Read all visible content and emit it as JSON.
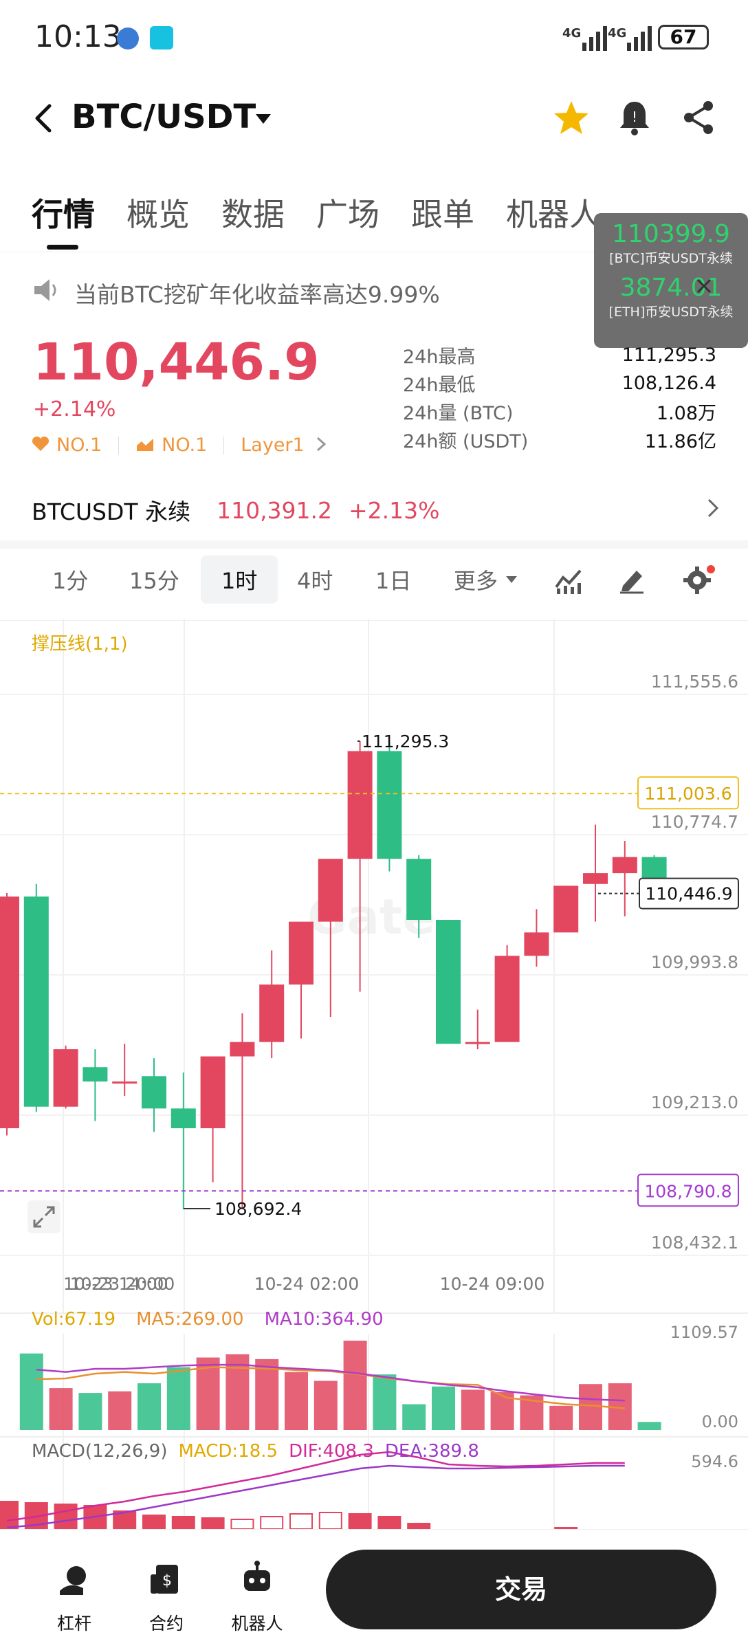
{
  "status_bar": {
    "time": "10:13",
    "battery": "67",
    "net1": "4G",
    "net2": "4G"
  },
  "header": {
    "pair": "BTC/USDT"
  },
  "tabs": [
    {
      "label": "行情",
      "active": true
    },
    {
      "label": "概览"
    },
    {
      "label": "数据"
    },
    {
      "label": "广场"
    },
    {
      "label": "跟单"
    },
    {
      "label": "机器人"
    }
  ],
  "float_widget": {
    "btc_price": "110399.9",
    "btc_label": "[BTC]币安USDT永续",
    "eth_price": "3874.01",
    "eth_label": "[ETH]币安USDT永续"
  },
  "announcement": "当前BTC挖矿年化收益率高达9.99%",
  "price": {
    "last": "110,446.9",
    "change": "+2.14%",
    "tags": [
      "NO.1",
      "NO.1",
      "Layer1"
    ]
  },
  "stats": [
    {
      "label": "24h最高",
      "value": "111,295.3"
    },
    {
      "label": "24h最低",
      "value": "108,126.4"
    },
    {
      "label": "24h量 (BTC)",
      "value": "1.08万"
    },
    {
      "label": "24h额 (USDT)",
      "value": "11.86亿"
    }
  ],
  "perp": {
    "name": "BTCUSDT 永续",
    "price": "110,391.2",
    "change": "+2.13%"
  },
  "timeframes": [
    "1分",
    "15分",
    "1时",
    "4时",
    "1日",
    "更多"
  ],
  "chart": {
    "indicator": "撑压线(1,1)",
    "watermark": "Gate",
    "price_ticks": [
      "111,555.6",
      "110,774.7",
      "109,993.8",
      "109,213.0",
      "108,432.1"
    ],
    "resistance": "111,003.6",
    "support": "108,790.8",
    "current": "110,446.9",
    "high_label": "111,295.3",
    "low_label": "108,692.4",
    "time_ticks": [
      "10-23 14:00",
      "10-23 20:00",
      "10-24 02:00",
      "10-24 09:00"
    ],
    "vol_label": "Vol:67.19",
    "ma5_label": "MA5:269.00",
    "ma10_label": "MA10:364.90",
    "vol_ticks": [
      "1109.57",
      "0.00"
    ],
    "macd_title": "MACD(12,26,9)",
    "macd_label": "MACD:18.5",
    "dif_label": "DIF:408.3",
    "dea_label": "DEA:389.8",
    "macd_tick": "594.6",
    "colors": {
      "up": "#e2475f",
      "down": "#2dbd85",
      "support": "#a33bd0",
      "resistance": "#f0c020"
    }
  },
  "chart_data": {
    "type": "candlestick",
    "interval": "1时",
    "candles": [
      {
        "o": 109140,
        "h": 110450,
        "l": 109100,
        "c": 110430
      },
      {
        "o": 110430,
        "h": 110500,
        "l": 109230,
        "c": 109260
      },
      {
        "o": 109260,
        "h": 109600,
        "l": 109250,
        "c": 109580
      },
      {
        "o": 109480,
        "h": 109580,
        "l": 109180,
        "c": 109400
      },
      {
        "o": 109400,
        "h": 109610,
        "l": 109320,
        "c": 109400
      },
      {
        "o": 109430,
        "h": 109530,
        "l": 109120,
        "c": 109250
      },
      {
        "o": 109250,
        "h": 109450,
        "l": 108692,
        "c": 109140
      },
      {
        "o": 109140,
        "h": 109500,
        "l": 108840,
        "c": 109540
      },
      {
        "o": 109540,
        "h": 109780,
        "l": 108692,
        "c": 109620
      },
      {
        "o": 109620,
        "h": 110130,
        "l": 109530,
        "c": 109940
      },
      {
        "o": 109940,
        "h": 110270,
        "l": 109640,
        "c": 110290
      },
      {
        "o": 110290,
        "h": 110560,
        "l": 109760,
        "c": 110640
      },
      {
        "o": 110640,
        "h": 111295,
        "l": 109900,
        "c": 111240
      },
      {
        "o": 111240,
        "h": 111295,
        "l": 110570,
        "c": 110640
      },
      {
        "o": 110640,
        "h": 110660,
        "l": 110200,
        "c": 110300
      },
      {
        "o": 110300,
        "h": 110300,
        "l": 109610,
        "c": 109610
      },
      {
        "o": 109610,
        "h": 109800,
        "l": 109580,
        "c": 109620
      },
      {
        "o": 109620,
        "h": 110160,
        "l": 109620,
        "c": 110100
      },
      {
        "o": 110100,
        "h": 110360,
        "l": 110040,
        "c": 110230
      },
      {
        "o": 110230,
        "h": 110490,
        "l": 110240,
        "c": 110490
      },
      {
        "o": 110500,
        "h": 110830,
        "l": 110290,
        "c": 110560
      },
      {
        "o": 110560,
        "h": 110740,
        "l": 110320,
        "c": 110650
      },
      {
        "o": 110650,
        "h": 110660,
        "l": 110410,
        "c": 110450
      }
    ],
    "volume": [
      950,
      520,
      460,
      480,
      580,
      780,
      900,
      940,
      880,
      720,
      610,
      1109,
      690,
      320,
      540,
      500,
      470,
      430,
      300,
      570,
      580,
      100
    ],
    "ma5": [
      630,
      640,
      700,
      720,
      700,
      740,
      780,
      770,
      760,
      740,
      730,
      690,
      640,
      600,
      570,
      560,
      400,
      360,
      320,
      300,
      269
    ],
    "ma10": [
      750,
      720,
      760,
      760,
      780,
      800,
      810,
      810,
      780,
      760,
      740,
      700,
      650,
      600,
      560,
      530,
      480,
      440,
      400,
      380,
      364.9
    ]
  }
}
